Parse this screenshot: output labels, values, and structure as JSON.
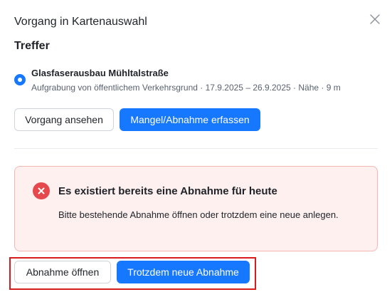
{
  "header": {
    "title": "Vorgang in Kartenauswahl"
  },
  "close_icon": "close-icon",
  "results": {
    "heading": "Treffer",
    "items": [
      {
        "selected": true,
        "title": "Glasfaserausbau Mühltalstraße",
        "meta": "Aufgrabung von öffentlichem Verkehrsgrund  ·  17.9.2025 – 26.9.2025  ·  Nähe · 9 m"
      }
    ]
  },
  "actions": {
    "view_label": "Vorgang ansehen",
    "capture_label": "Mangel/Abnahme erfassen"
  },
  "alert": {
    "icon": "error-icon",
    "title": "Es existiert bereits eine Abnahme für heute",
    "text": "Bitte bestehende Abnahme öffnen oder trotzdem eine neue anlegen."
  },
  "alert_actions": {
    "open_label": "Abnahme öffnen",
    "new_label": "Trotzdem neue Abnahme"
  },
  "colors": {
    "primary": "#1677ff",
    "error": "#e5484d",
    "alert_bg": "#fdf0ef",
    "alert_border": "#f4b7b2",
    "highlight": "#d81b1b"
  }
}
